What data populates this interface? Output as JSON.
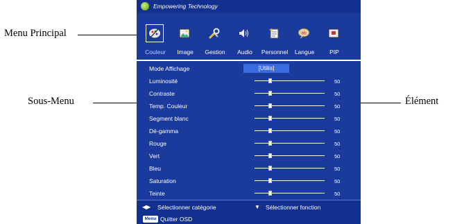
{
  "callouts": {
    "menu_principal": "Menu Principal",
    "sous_menu": "Sous-Menu",
    "element": "Élément"
  },
  "header": {
    "brand": "Empowering Technology"
  },
  "tabs": [
    {
      "label": "Couleur",
      "icon": "palette-icon",
      "active": true
    },
    {
      "label": "Image",
      "icon": "image-icon"
    },
    {
      "label": "Gestion",
      "icon": "tools-icon"
    },
    {
      "label": "Audio",
      "icon": "speaker-icon"
    },
    {
      "label": "Personnel",
      "icon": "personal-icon"
    },
    {
      "label": "Langue",
      "icon": "language-icon"
    },
    {
      "label": "PIP",
      "icon": "pip-icon"
    }
  ],
  "rows": [
    {
      "name": "Mode Affichage",
      "value": "[Utilis]"
    },
    {
      "name": "Luminosité",
      "value": "50",
      "level": 0.22
    },
    {
      "name": "Contraste",
      "value": "50",
      "level": 0.22
    },
    {
      "name": "Temp. Couleur",
      "value": "50",
      "level": 0.22
    },
    {
      "name": "Segment blanc",
      "value": "50",
      "level": 0.22
    },
    {
      "name": "Dé-gamma",
      "value": "50",
      "level": 0.22
    },
    {
      "name": "Rouge",
      "value": "50",
      "level": 0.22
    },
    {
      "name": "Vert",
      "value": "50",
      "level": 0.22
    },
    {
      "name": "Bleu",
      "value": "50",
      "level": 0.22
    },
    {
      "name": "Saturation",
      "value": "50",
      "level": 0.22
    },
    {
      "name": "Teinte",
      "value": "50",
      "level": 0.22
    }
  ],
  "footer": {
    "select_category": "Sélectionner catégorie",
    "select_function": "Sélectionner fonction",
    "menu_key": "Menu",
    "quit": "Quitter OSD"
  },
  "colors": {
    "osd_bg": "#1a3a9c",
    "accent": "#3a6be0",
    "active_tab": "#b5d0ff"
  }
}
